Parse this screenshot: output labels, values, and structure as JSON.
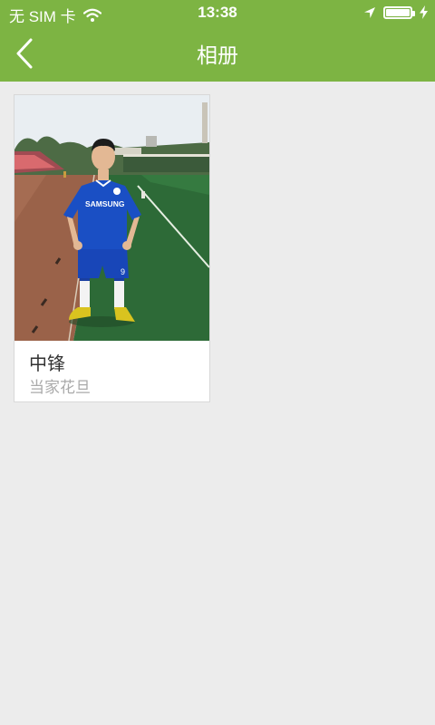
{
  "status_bar": {
    "carrier": "无 SIM 卡",
    "time": "13:38",
    "icons": [
      "wifi-icon",
      "location-arrow-icon",
      "battery-icon",
      "charging-bolt-icon"
    ]
  },
  "nav_bar": {
    "title": "相册",
    "back_icon": "chevron-left-icon"
  },
  "albums": [
    {
      "name": "中锋",
      "description": "当家花旦",
      "photo": "football-player-photo",
      "jersey_text": "SAMSUNG",
      "jersey_number": "9"
    }
  ],
  "colors": {
    "accent": "#7db443",
    "background": "#ececec",
    "card": "#ffffff",
    "secondary_text": "#aaaaaa"
  }
}
